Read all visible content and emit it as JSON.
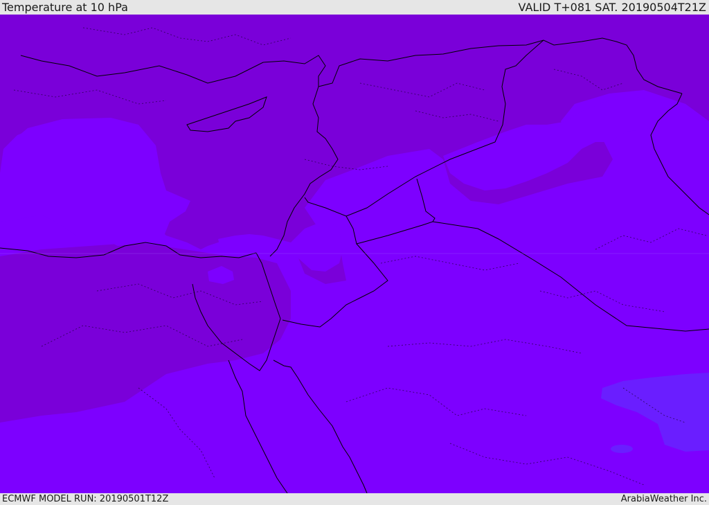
{
  "header": {
    "title": "Temperature at 10 hPa",
    "valid_time": "VALID T+081 SAT. 20190504T21Z"
  },
  "footer": {
    "model_run": "ECMWF MODEL RUN: 20190501T12Z",
    "credit": "ArabiaWeather Inc."
  },
  "colors": {
    "base_fill": "#7d00ff",
    "dark_fill": "#7a00d9",
    "cool_fill": "#6a1eff",
    "border_line": "#000000",
    "frame": "#e6e6e6"
  }
}
